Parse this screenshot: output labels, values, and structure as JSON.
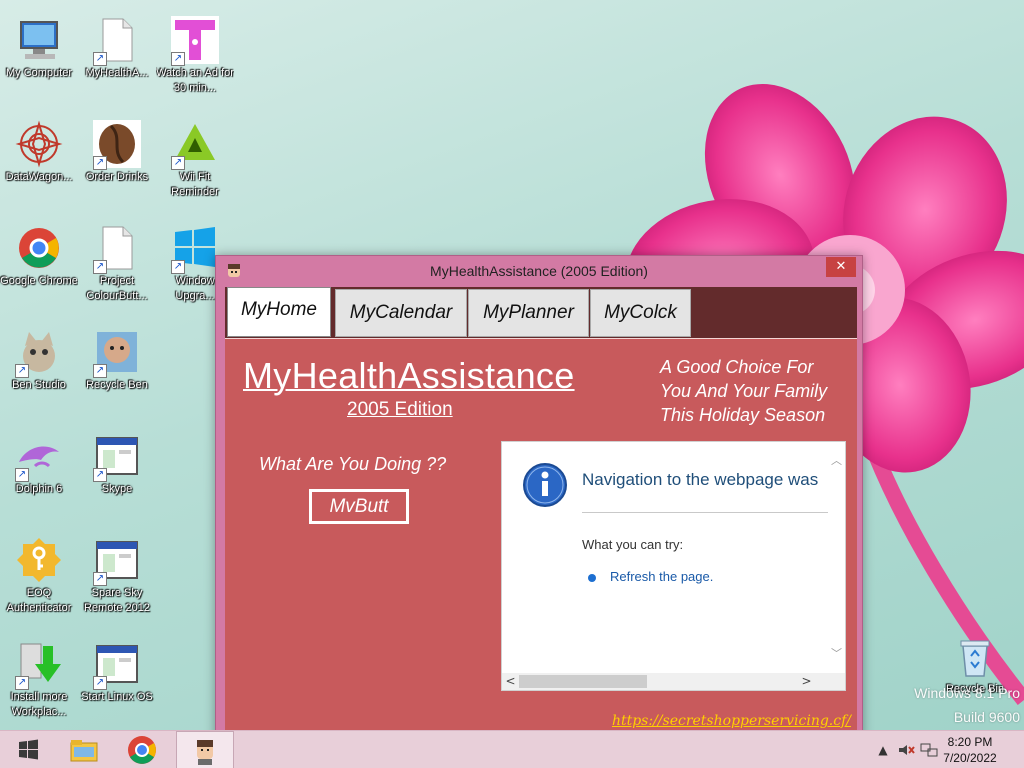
{
  "desktop": {
    "icons": [
      {
        "label": "My Computer",
        "icon": "computer-icon",
        "shortcut": false
      },
      {
        "label": "MyHealthA...",
        "icon": "document-icon",
        "shortcut": true
      },
      {
        "label": "Watch an Ad for 30 min...",
        "icon": "t-logo-icon",
        "shortcut": true
      },
      {
        "label": "DataWagon...",
        "icon": "mandala-icon",
        "shortcut": false
      },
      {
        "label": "Order Drinks",
        "icon": "coffee-bean-icon",
        "shortcut": true
      },
      {
        "label": "Wii Fit Reminder",
        "icon": "triforce-icon",
        "shortcut": true
      },
      {
        "label": "Google Chrome",
        "icon": "chrome-icon",
        "shortcut": false
      },
      {
        "label": "Project ColourButt...",
        "icon": "document-icon",
        "shortcut": true
      },
      {
        "label": "Window Upgra...",
        "icon": "windows-logo-icon",
        "shortcut": true
      },
      {
        "label": "Ben Studio",
        "icon": "cat-icon",
        "shortcut": true
      },
      {
        "label": "Recycle Ben",
        "icon": "face-icon",
        "shortcut": true
      },
      {
        "label": "Dolphin 6",
        "icon": "dolphin-icon",
        "shortcut": true
      },
      {
        "label": "Skype",
        "icon": "window-app-icon",
        "shortcut": true
      },
      {
        "label": "EOQ Authenticator",
        "icon": "key-badge-icon",
        "shortcut": false
      },
      {
        "label": "Spare Sky Remote 2012",
        "icon": "window-app-icon",
        "shortcut": true
      },
      {
        "label": "Install more Workplac...",
        "icon": "install-arrow-icon",
        "shortcut": true
      },
      {
        "label": "Start Linux OS",
        "icon": "window-app-icon",
        "shortcut": true
      }
    ],
    "recycle_bin": {
      "label": "Recycle Bin",
      "icon": "recycle-bin-icon"
    },
    "watermark": {
      "line1": "Windows 8.1 Pro",
      "line2": "Build 9600"
    }
  },
  "window": {
    "title": "MyHealthAssistance (2005 Edition)",
    "close_symbol": "✕",
    "tabs": [
      {
        "label": "MyHome",
        "active": true
      },
      {
        "label": "MyCalendar",
        "active": false
      },
      {
        "label": "MyPlanner",
        "active": false
      },
      {
        "label": "MyColck",
        "active": false
      }
    ],
    "content": {
      "app_title": "MyHealthAssistance",
      "app_subtitle": "2005 Edition",
      "slogan_line1": "A Good Choice For",
      "slogan_line2": "You And Your Family",
      "slogan_line3": "This Holiday Season",
      "question": "What Are You Doing ??",
      "button_label": "MvButt",
      "browser": {
        "message": "Navigation to the webpage was",
        "try_text": "What you can try:",
        "refresh_link": "Refresh the page."
      },
      "url": "https://secretshopperservicing.cf/"
    }
  },
  "taskbar": {
    "clock_time": "8:20 PM",
    "clock_date": "7/20/2022",
    "tray_up_arrow": "▲"
  },
  "colors": {
    "window_frame": "#d37aa4",
    "client_bg": "#c85a5c",
    "tabstrip_bg": "#632b2c",
    "url_color": "#ffd000",
    "taskbar_bg": "#e8cfd9"
  }
}
